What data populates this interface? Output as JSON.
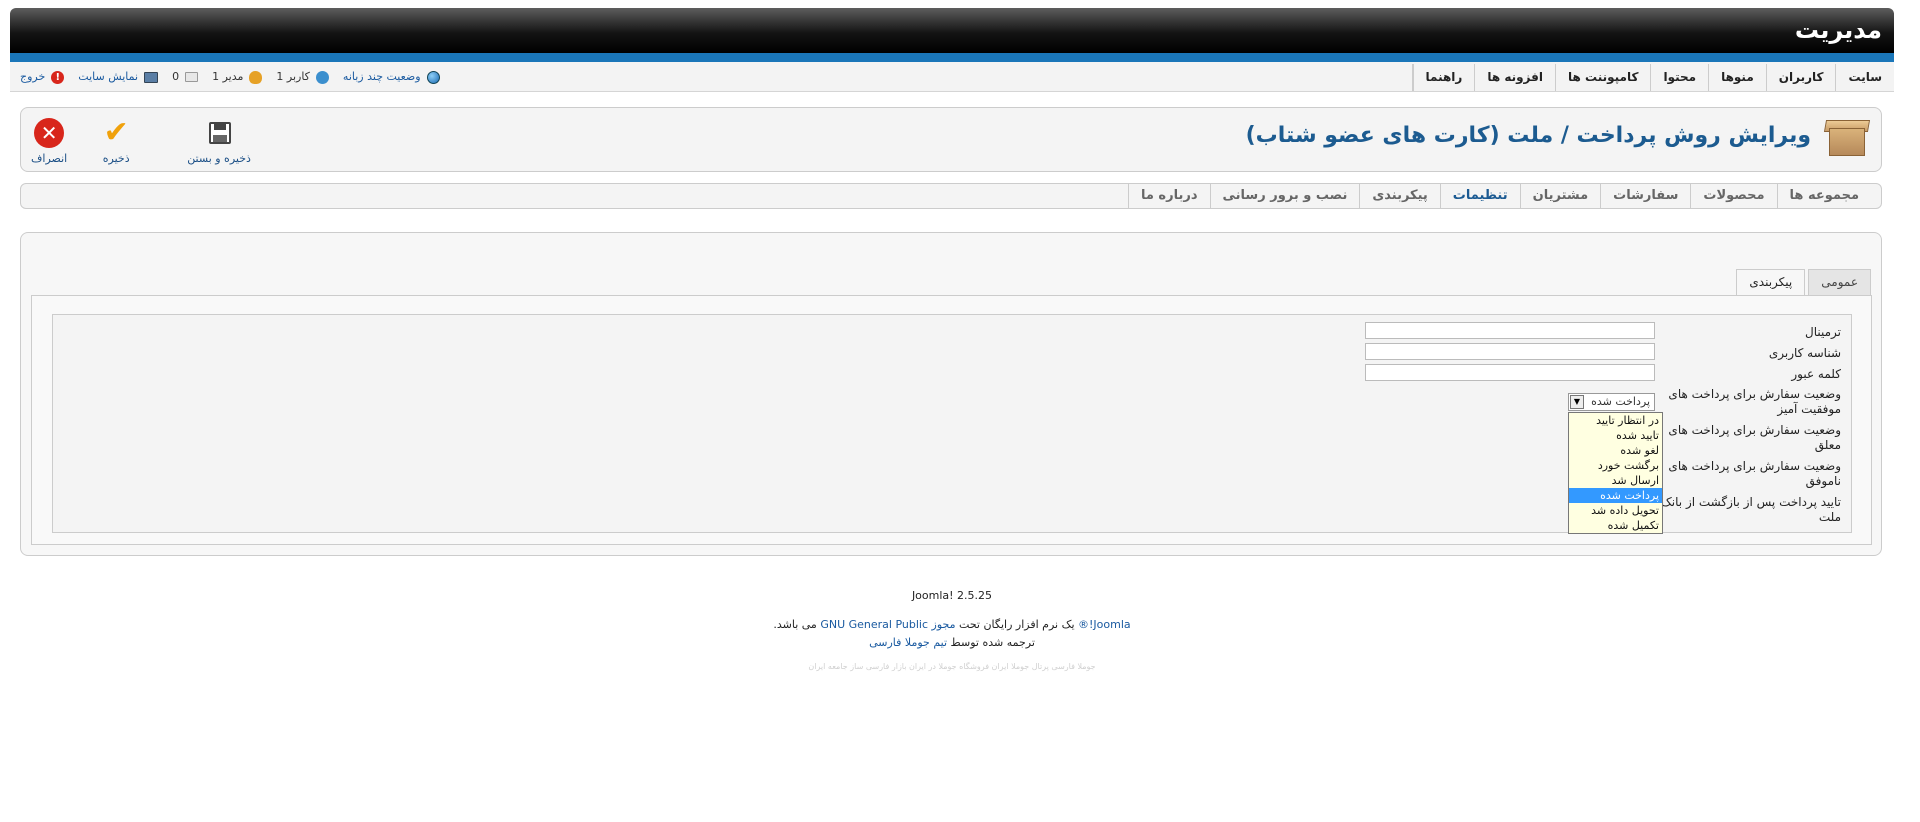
{
  "header": {
    "brand": "مدیریت"
  },
  "menu": {
    "items": [
      "سایت",
      "کاربران",
      "منوها",
      "محتوا",
      "کامپوننت ها",
      "افزونه ها",
      "راهنما"
    ]
  },
  "status": {
    "logout": "خروج",
    "view_site": "نمایش سایت",
    "messages": "0",
    "admins": "1 مدیر",
    "users": "1 کاربر",
    "multilang": "وضعیت چند زبانه"
  },
  "toolbar": {
    "title": "ویرایش روش پرداخت / ملت (کارت های عضو شتاب)",
    "cancel": "انصراف",
    "save": "ذخیره",
    "save_close": "ذخیره و بستن"
  },
  "submenu": {
    "items": [
      "مجموعه ها",
      "محصولات",
      "سفارشات",
      "مشتریان",
      "تنظیمات",
      "پیکربندی",
      "نصب و برور رسانی",
      "درباره ما"
    ],
    "active": "تنظیمات"
  },
  "tabs": {
    "general": "عمومی",
    "config": "پیکربندی"
  },
  "form": {
    "terminal_label": "ترمینال",
    "username_label": "شناسه کاربری",
    "password_label": "کلمه عبور",
    "success_label": "وضعیت سفارش برای پرداخت های موفقیت آمیز",
    "pending_label": "وضعیت سفارش برای پرداخت های معلق",
    "failed_label": "وضعیت سفارش برای پرداخت های ناموفق",
    "verify_label": "تایید پرداخت پس از بازگشت از بانک ملت",
    "selected_status": "پرداخت شده",
    "status_options": [
      "در انتظار تایید",
      "تایید شده",
      "لغو شده",
      "برگشت خورد",
      "ارسال شد",
      "پرداخت شده",
      "تحویل داده شد",
      "تکمیل شده"
    ]
  },
  "footer": {
    "version": "Joomla! 2.5.25",
    "license_joomla": "Joomla!®",
    "license_mid": "یک نرم افزار رایگان تحت",
    "license_link": "مجوز GNU General Public",
    "license_end": "می باشد.",
    "translated_by": "ترجمه شده توسط",
    "team": "تیم جوملا فارسی",
    "faint_line": "جوملا فارسی پرتال جوملا ایران فروشگاه جوملا در ایران بازار فارسی ساز جامعه ایران"
  }
}
